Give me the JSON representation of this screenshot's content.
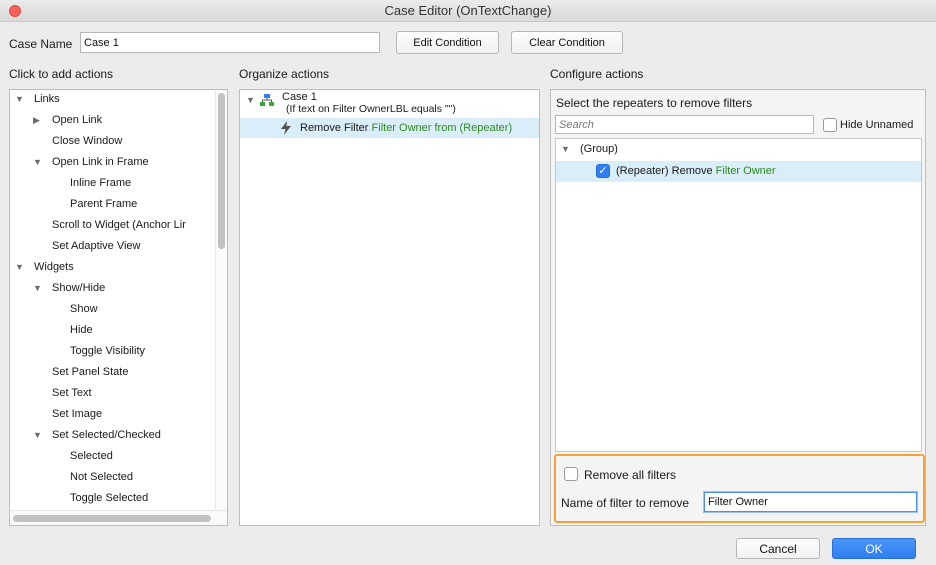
{
  "window": {
    "title": "Case Editor (OnTextChange)"
  },
  "case_name": {
    "label": "Case Name",
    "value": "Case 1"
  },
  "buttons": {
    "edit_condition": "Edit Condition",
    "clear_condition": "Clear Condition",
    "cancel": "Cancel",
    "ok": "OK"
  },
  "columns": {
    "add_actions": "Click to add actions",
    "organize_actions": "Organize actions",
    "configure_actions": "Configure actions"
  },
  "actions_tree": [
    {
      "label": "Links",
      "level": 0,
      "expander": "open"
    },
    {
      "label": "Open Link",
      "level": 1,
      "expander": "closed"
    },
    {
      "label": "Close Window",
      "level": 1,
      "expander": "none"
    },
    {
      "label": "Open Link in Frame",
      "level": 1,
      "expander": "open"
    },
    {
      "label": "Inline Frame",
      "level": 2,
      "expander": "none"
    },
    {
      "label": "Parent Frame",
      "level": 2,
      "expander": "none"
    },
    {
      "label": "Scroll to Widget (Anchor Lir",
      "level": 1,
      "expander": "none"
    },
    {
      "label": "Set Adaptive View",
      "level": 1,
      "expander": "none"
    },
    {
      "label": "Widgets",
      "level": 0,
      "expander": "open"
    },
    {
      "label": "Show/Hide",
      "level": 1,
      "expander": "open"
    },
    {
      "label": "Show",
      "level": 2,
      "expander": "none"
    },
    {
      "label": "Hide",
      "level": 2,
      "expander": "none"
    },
    {
      "label": "Toggle Visibility",
      "level": 2,
      "expander": "none"
    },
    {
      "label": "Set Panel State",
      "level": 1,
      "expander": "none"
    },
    {
      "label": "Set Text",
      "level": 1,
      "expander": "none"
    },
    {
      "label": "Set Image",
      "level": 1,
      "expander": "none"
    },
    {
      "label": "Set Selected/Checked",
      "level": 1,
      "expander": "open"
    },
    {
      "label": "Selected",
      "level": 2,
      "expander": "none"
    },
    {
      "label": "Not Selected",
      "level": 2,
      "expander": "none"
    },
    {
      "label": "Toggle Selected",
      "level": 2,
      "expander": "none"
    }
  ],
  "organize": {
    "case_title": "Case 1",
    "case_condition": "(If text on Filter OwnerLBL equals \"\")",
    "action_prefix": "Remove Filter ",
    "action_target": "Filter Owner from (Repeater)"
  },
  "configure": {
    "heading": "Select the repeaters to remove filters",
    "search_placeholder": "Search",
    "hide_unnamed": "Hide Unnamed",
    "group_label": "(Group)",
    "repeater_prefix": "(Repeater) Remove ",
    "repeater_target": "Filter Owner",
    "remove_all_filters": "Remove all filters",
    "filter_name_label": "Name of filter to remove",
    "filter_name_value": "Filter Owner"
  },
  "colors": {
    "accent": "#2f7ff2",
    "highlight": "#f3a23a",
    "selection": "#d9eef8",
    "green": "#2e8b21"
  }
}
